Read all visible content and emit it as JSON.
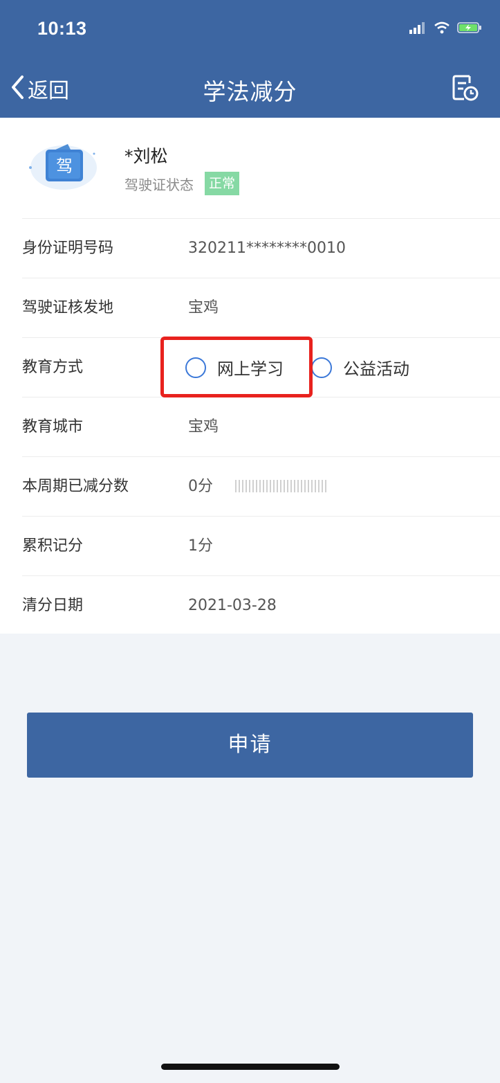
{
  "status_bar": {
    "time": "10:13",
    "signal_icon": "signal-icon",
    "wifi_icon": "wifi-icon",
    "battery_icon": "battery-charging-icon"
  },
  "nav": {
    "back_label": "返回",
    "title": "学法减分",
    "record_icon": "record-clock-icon"
  },
  "profile": {
    "license_icon_text": "驾",
    "name": "*刘松",
    "status_label": "驾驶证状态",
    "status_value": "正常"
  },
  "rows": {
    "id_number": {
      "label": "身份证明号码",
      "value": "320211********0010"
    },
    "issue_place": {
      "label": "驾驶证核发地",
      "value": "宝鸡"
    },
    "education_method": {
      "label": "教育方式",
      "options": [
        "网上学习",
        "公益活动"
      ]
    },
    "education_city": {
      "label": "教育城市",
      "value": "宝鸡"
    },
    "deducted_this_cycle": {
      "label": "本周期已减分数",
      "value": "0分"
    },
    "accumulated_points": {
      "label": "累积记分",
      "value": "1分"
    },
    "clear_date": {
      "label": "清分日期",
      "value": "2021-03-28"
    }
  },
  "apply_button": {
    "label": "申请"
  },
  "colors": {
    "header_bg": "#3d66a2",
    "badge_bg": "#86d9a4",
    "radio_border": "#3b78d8",
    "highlight": "#e8221e",
    "page_bg": "#f1f4f8"
  }
}
